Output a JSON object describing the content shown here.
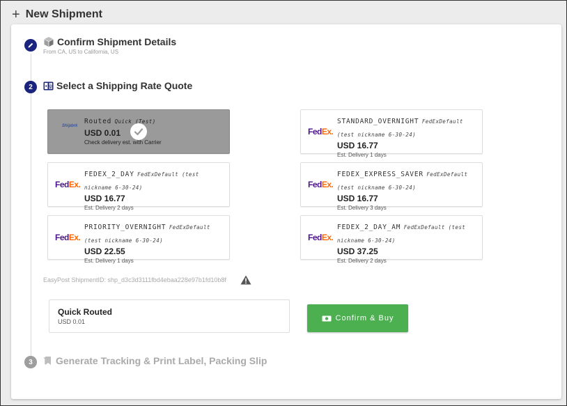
{
  "header": {
    "title": "New Shipment"
  },
  "step1": {
    "title": "Confirm Shipment Details",
    "subtitle": "From CA, US to California, US"
  },
  "step2": {
    "number": "2",
    "title": "Select a Shipping Rate Quote"
  },
  "rates": [
    {
      "service": "Routed",
      "carrier": "Quick (Test)",
      "price": "USD 0.01",
      "detail": "Check delivery est. with Carrier",
      "logo": "shipbrk",
      "logo_text": "Shipbrk",
      "selected": true
    },
    {
      "service": "STANDARD_OVERNIGHT",
      "carrier": "FedExDefault (test nickname 6-30-24)",
      "price": "USD 16.77",
      "detail": "Est. Delivery 1 days",
      "logo": "fedex",
      "selected": false
    },
    {
      "service": "FEDEX_2_DAY",
      "carrier": "FedExDefault (test nickname 6-30-24)",
      "price": "USD 16.77",
      "detail": "Est. Delivery 2 days",
      "logo": "fedex",
      "selected": false
    },
    {
      "service": "FEDEX_EXPRESS_SAVER",
      "carrier": "FedExDefault (test nickname 6-30-24)",
      "price": "USD 16.77",
      "detail": "Est. Delivery 3 days",
      "logo": "fedex",
      "selected": false
    },
    {
      "service": "PRIORITY_OVERNIGHT",
      "carrier": "FedExDefault (test nickname 6-30-24)",
      "price": "USD 22.55",
      "detail": "Est. Delivery 1 days",
      "logo": "fedex",
      "selected": false
    },
    {
      "service": "FEDEX_2_DAY_AM",
      "carrier": "FedExDefault (test nickname 6-30-24)",
      "price": "USD 37.25",
      "detail": "Est. Delivery 2 days",
      "logo": "fedex",
      "selected": false
    }
  ],
  "fedex_logo": {
    "fe": "Fed",
    "ex": "Ex."
  },
  "easypost": {
    "label": "EasyPost ShipmentID: shp_d3c3d3111fbd4ebaa228e97b1fd10b8f"
  },
  "summary": {
    "name": "Quick Routed",
    "amount": "USD 0.01"
  },
  "buy_button": {
    "label": "Confirm & Buy"
  },
  "step3": {
    "number": "3",
    "title": "Generate Tracking & Print Label, Packing Slip"
  },
  "colors": {
    "step_active": "#1a237e",
    "step_inactive": "#9e9e9e",
    "buy": "#4caf50",
    "fedex_purple": "#4d148c",
    "fedex_orange": "#ff6600"
  },
  "icons": {
    "plus": "plus-icon",
    "pencil": "pencil-icon",
    "box": "box-icon",
    "calculator": "calculator-icon",
    "check": "check-icon",
    "warning": "warning-icon",
    "money": "money-icon",
    "bookmark": "bookmark-icon"
  }
}
